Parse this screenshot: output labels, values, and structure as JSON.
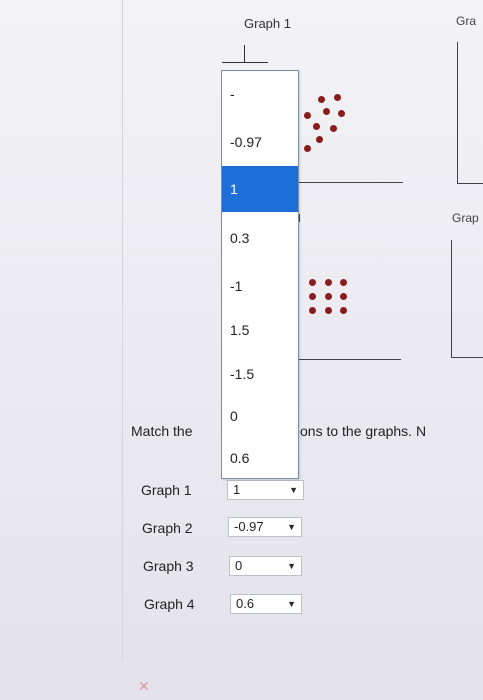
{
  "graphs": {
    "graph1_title": "Graph 1",
    "graph2_title": "Gra",
    "graph4_title": "Grap"
  },
  "dropdown": {
    "options": [
      "-",
      "-0.97",
      "1",
      "0.3",
      "-1",
      "1.5",
      "-1.5",
      "0",
      "0.6"
    ],
    "selected": "1"
  },
  "instruction": {
    "left": "Match the",
    "right": "ons to the graphs. N"
  },
  "matches": [
    {
      "label": "Graph 1",
      "value": "1"
    },
    {
      "label": "Graph 2",
      "value": "-0.97"
    },
    {
      "label": "Graph 3",
      "value": "0"
    },
    {
      "label": "Graph 4",
      "value": "0.6"
    }
  ],
  "icons": {
    "dropdown_arrow": "chevron-down-icon",
    "status_mark": "close-icon"
  },
  "colors": {
    "selected_bg": "#1f6fd9",
    "dot": "#8a1c1c"
  }
}
